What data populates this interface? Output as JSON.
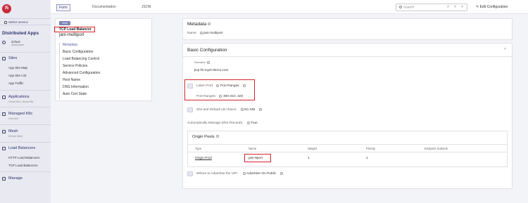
{
  "sidebar": {
    "logo_text": "f5",
    "select_service": "Select service",
    "app_title": "Distributed Apps",
    "namespace": {
      "name": "default",
      "sub": "Namespace"
    },
    "sections": [
      {
        "title": "Sites",
        "items": [
          "App Site Map",
          "App Site List",
          "App Traffic"
        ]
      },
      {
        "title": "Applications",
        "sub": "Virtual Sites, Virtual K8s"
      },
      {
        "title": "Managed K8s",
        "sub": "Overview"
      },
      {
        "title": "Mesh",
        "sub": "Service Mesh"
      },
      {
        "title": "Load Balancers",
        "items": [
          "HTTP Load Balancers",
          "TCP Load Balancers"
        ]
      },
      {
        "title": "Manage"
      }
    ]
  },
  "topbar": {
    "tabs": [
      "Form",
      "Documentation",
      "JSON"
    ],
    "search_placeholder": "Search",
    "edit_configuration": "Edit Configuration"
  },
  "nav": {
    "view_badge": "View",
    "lb_type": "TCP Load Balancer",
    "lb_name": "jani-multiport",
    "items": [
      "Metadata",
      "Basic Configuration",
      "Load Balancing Control",
      "Service Policies",
      "Advanced Configuration",
      "Host Name",
      "DNS Information",
      "Auto Cert State"
    ]
  },
  "metadata": {
    "title": "Metadata",
    "name_label": "Name:",
    "name_value": "jani-multiport"
  },
  "basic": {
    "title": "Basic Configuration",
    "domains_label": "Domains",
    "domains_value": "jtcp-f5-mysl-demo.com",
    "listen_port_label": "Listen Port:",
    "listen_port_value": "Port Ranges",
    "port_ranges_label": "Port Ranges:",
    "port_ranges_value": "300-310, 320",
    "sni_label": "SNI and Default LB choice:",
    "sni_value": "No SNI",
    "dns_label": "Automatically Manage DNS Records:",
    "dns_value": "True"
  },
  "origin_pools": {
    "title": "Origin Pools",
    "columns": [
      "Type",
      "Name",
      "Weight",
      "Priority",
      "Endpoint Subsets"
    ],
    "rows": [
      {
        "type": "Origin Pool",
        "name": "jani-9port",
        "weight": "1",
        "priority": "1",
        "endpoint": ""
      }
    ]
  },
  "advertise": {
    "label": "Where to Advertise the VIP:",
    "value": "Advertise On Public"
  },
  "colors": {
    "sidebar_bg": "#e9e9f2",
    "accent": "#3a3f6b",
    "highlight_red": "#d3242a",
    "logo_red": "#c62b3a"
  }
}
